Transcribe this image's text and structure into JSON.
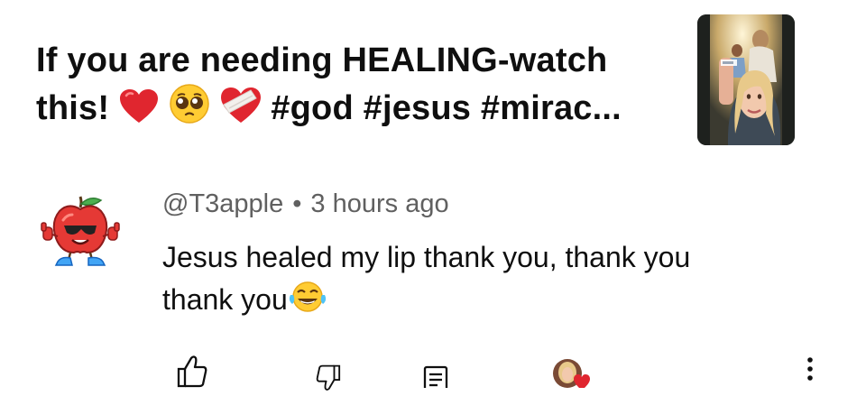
{
  "video": {
    "title_line1": "If you are needing HEALING-watch",
    "title_line2_prefix": "this!",
    "title_emojis": [
      "red-heart",
      "pleading-face",
      "mending-heart"
    ],
    "title_line2_suffix": "#god #jesus #mirac..."
  },
  "comment": {
    "author": "@T3apple",
    "separator": "•",
    "time": "3 hours ago",
    "text_line1": "Jesus healed my lip thank you, thank you",
    "text_line2": "thank you",
    "trailing_emoji": "face-with-tears-of-joy"
  },
  "actions": {
    "icons": [
      "thumbs-up",
      "thumbs-down",
      "reply",
      "creator-heart-avatar",
      "more-vert"
    ]
  },
  "colors": {
    "title_text": "#0f0f0f",
    "meta_text": "#606060",
    "heart_red": "#e0262f"
  }
}
